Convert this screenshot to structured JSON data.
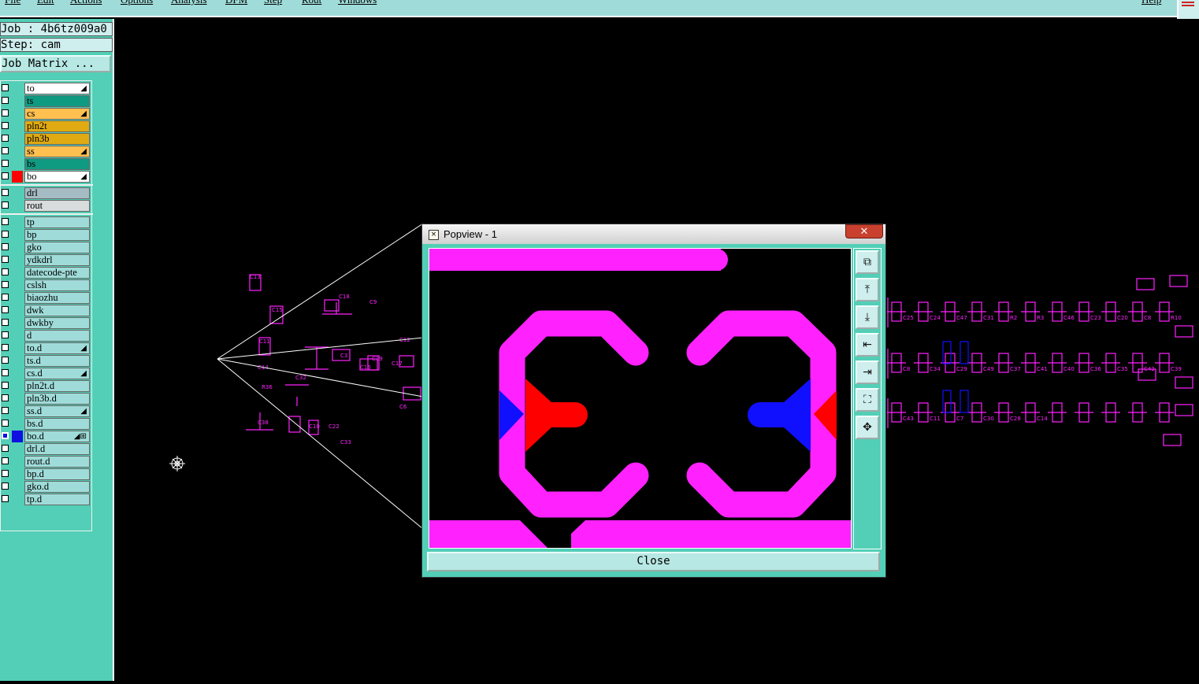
{
  "menubar": {
    "items": [
      "File",
      "Edit",
      "Actions",
      "Options",
      "Analysis",
      "DFM",
      "Step",
      "Rout",
      "Windows"
    ],
    "help": "Help"
  },
  "job": {
    "job_label": "Job : 4b6tz009a0",
    "step_label": "Step: cam",
    "matrix_button": "Job Matrix ..."
  },
  "layers": [
    {
      "name": "to",
      "color": "#ffffff",
      "swatch": "",
      "mark": "◢"
    },
    {
      "name": "ts",
      "color": "#0f9a82",
      "swatch": "",
      "mark": ""
    },
    {
      "name": "cs",
      "color": "#ffc050",
      "swatch": "",
      "mark": "◢"
    },
    {
      "name": "pln2t",
      "color": "#dfaa12",
      "swatch": "",
      "mark": ""
    },
    {
      "name": "pln3b",
      "color": "#dfaa12",
      "swatch": "",
      "mark": ""
    },
    {
      "name": "ss",
      "color": "#ffc050",
      "swatch": "",
      "mark": "◢"
    },
    {
      "name": "bs",
      "color": "#0f9a82",
      "swatch": "",
      "mark": ""
    },
    {
      "name": "bo",
      "color": "#ffffff",
      "swatch": "#ff0000",
      "mark": "◢"
    },
    {
      "name": "drl",
      "color": "#a6bcc4",
      "swatch": "",
      "mark": ""
    },
    {
      "name": "rout",
      "color": "#d8dcdc",
      "swatch": "",
      "mark": ""
    },
    {
      "name": "tp",
      "color": "#9fdcd9",
      "swatch": "",
      "mark": ""
    },
    {
      "name": "bp",
      "color": "#9fdcd9",
      "swatch": "",
      "mark": ""
    },
    {
      "name": "gko",
      "color": "#9fdcd9",
      "swatch": "",
      "mark": ""
    },
    {
      "name": "ydkdrl",
      "color": "#9fdcd9",
      "swatch": "",
      "mark": ""
    },
    {
      "name": "datecode-pte",
      "color": "#9fdcd9",
      "swatch": "",
      "mark": ""
    },
    {
      "name": "cslsh",
      "color": "#9fdcd9",
      "swatch": "",
      "mark": ""
    },
    {
      "name": "biaozhu",
      "color": "#9fdcd9",
      "swatch": "",
      "mark": ""
    },
    {
      "name": "dwk",
      "color": "#9fdcd9",
      "swatch": "",
      "mark": ""
    },
    {
      "name": "dwkby",
      "color": "#9fdcd9",
      "swatch": "",
      "mark": ""
    },
    {
      "name": "d",
      "color": "#9fdcd9",
      "swatch": "",
      "mark": ""
    },
    {
      "name": "to.d",
      "color": "#9fdcd9",
      "swatch": "",
      "mark": "◢"
    },
    {
      "name": "ts.d",
      "color": "#9fdcd9",
      "swatch": "",
      "mark": ""
    },
    {
      "name": "cs.d",
      "color": "#9fdcd9",
      "swatch": "",
      "mark": "◢"
    },
    {
      "name": "pln2t.d",
      "color": "#9fdcd9",
      "swatch": "",
      "mark": ""
    },
    {
      "name": "pln3b.d",
      "color": "#9fdcd9",
      "swatch": "",
      "mark": ""
    },
    {
      "name": "ss.d",
      "color": "#9fdcd9",
      "swatch": "",
      "mark": "◢"
    },
    {
      "name": "bs.d",
      "color": "#9fdcd9",
      "swatch": "",
      "mark": ""
    },
    {
      "name": "bo.d",
      "color": "#9fdcd9",
      "swatch": "#1010e0",
      "mark": "◢⊞"
    },
    {
      "name": "drl.d",
      "color": "#9fdcd9",
      "swatch": "",
      "mark": ""
    },
    {
      "name": "rout.d",
      "color": "#9fdcd9",
      "swatch": "",
      "mark": ""
    },
    {
      "name": "bp.d",
      "color": "#9fdcd9",
      "swatch": "",
      "mark": ""
    },
    {
      "name": "gko.d",
      "color": "#9fdcd9",
      "swatch": "",
      "mark": ""
    },
    {
      "name": "tp.d",
      "color": "#9fdcd9",
      "swatch": "",
      "mark": ""
    }
  ],
  "colors": {
    "silk": "#ff22ff",
    "pad_red": "#ff0000",
    "pad_blue": "#1010ff",
    "panel": "#52cfb6"
  },
  "popview": {
    "title": "Popview - 1",
    "close_x": "✕",
    "close_button": "Close",
    "tools": [
      "zoom-window-icon",
      "zoom-in-icon",
      "zoom-out-icon",
      "pan-left-icon",
      "pan-right-icon",
      "fit-icon",
      "center-icon"
    ]
  },
  "board_labels": {
    "left": [
      "C13",
      "C15",
      "C11",
      "C18",
      "C9",
      "C14",
      "C12",
      "C16",
      "C17",
      "R36",
      "C32",
      "C38",
      "C22",
      "C3",
      "C19",
      "C6",
      "C10",
      "C33"
    ],
    "right": [
      "C25",
      "C24",
      "C47",
      "C31",
      "R2",
      "R3",
      "C46",
      "C23",
      "C20",
      "C8",
      "R10",
      "C8",
      "C34",
      "C29",
      "C49",
      "C37",
      "C41",
      "C40",
      "C36",
      "C35",
      "C42",
      "C39",
      "C43",
      "C11",
      "C7",
      "C30",
      "C28",
      "C14"
    ]
  }
}
